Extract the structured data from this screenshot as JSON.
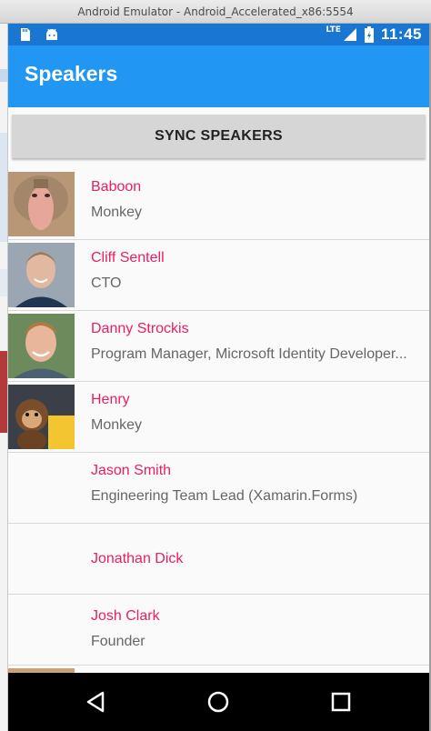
{
  "window": {
    "title": "Android Emulator - Android_Accelerated_x86:5554"
  },
  "status_bar": {
    "network": "LTE",
    "time": "11:45",
    "bar_color": "#1976d2"
  },
  "app_bar": {
    "title": "Speakers",
    "color": "#2196f3"
  },
  "sync_button": {
    "label": "SYNC SPEAKERS"
  },
  "speakers": [
    {
      "name": "Baboon",
      "title": "Monkey",
      "avatar": "baboon-photo"
    },
    {
      "name": "Cliff Sentell",
      "title": "CTO",
      "avatar": "cliff-photo"
    },
    {
      "name": "Danny Strockis",
      "title": "Program Manager, Microsoft Identity Developer...",
      "avatar": "danny-photo"
    },
    {
      "name": "Henry",
      "title": "Monkey",
      "avatar": "henry-photo"
    },
    {
      "name": "Jason Smith",
      "title": "Engineering Team Lead (Xamarin.Forms)",
      "avatar": ""
    },
    {
      "name": "Jonathan Dick",
      "title": "",
      "avatar": ""
    },
    {
      "name": "Josh Clark",
      "title": "Founder",
      "avatar": ""
    }
  ],
  "colors": {
    "name_text": "#e91e63",
    "role_text": "#666666"
  },
  "nav": {
    "back": "back-icon",
    "home": "home-icon",
    "recents": "recents-icon"
  }
}
